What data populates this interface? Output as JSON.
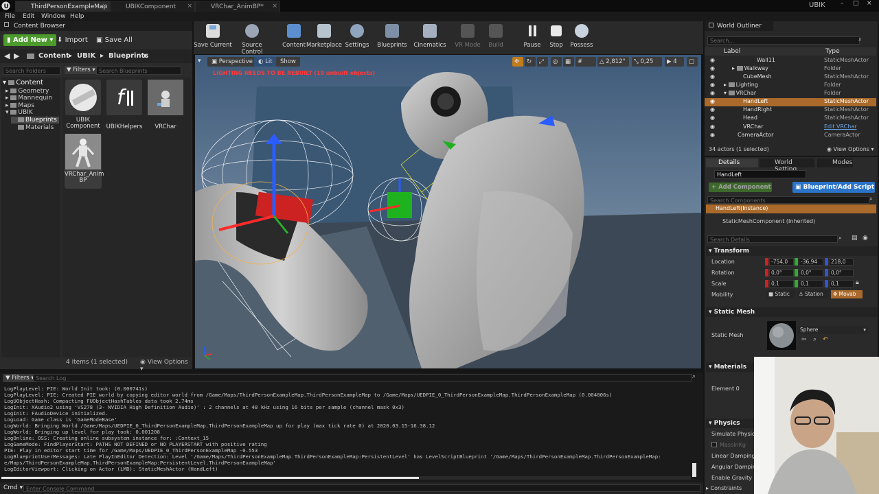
{
  "tabs": {
    "map": "ThirdPersonExampleMap",
    "ubik_component": "UBIKComponent",
    "anim_bp": "VRChar_AnimBP*",
    "right_label": "UBIK"
  },
  "menu": {
    "file": "File",
    "edit": "Edit",
    "window": "Window",
    "help": "Help"
  },
  "content_browser": {
    "title": "Content Browser",
    "add_new": "Add New",
    "import": "Import",
    "save_all": "Save All",
    "breadcrumb": [
      "Content",
      "UBIK",
      "Blueprints"
    ],
    "search_folders_placeholder": "Search Folders",
    "filters": "Filters",
    "search_blueprints_placeholder": "Search Blueprints",
    "tree": [
      "Content",
      "Geometry",
      "Mannequin",
      "Maps",
      "UBIK",
      "Blueprints",
      "Materials"
    ],
    "assets": [
      {
        "name": "UBIK Component"
      },
      {
        "name": "UBIKHelpers"
      },
      {
        "name": "VRChar"
      },
      {
        "name": "VRChar_Anim BP"
      }
    ],
    "status": "4 items (1 selected)",
    "view_options": "View Options"
  },
  "toolbar": {
    "save_current": "Save Current",
    "source_control": "Source Control",
    "content": "Content",
    "marketplace": "Marketplace",
    "settings": "Settings",
    "blueprints": "Blueprints",
    "cinematics": "Cinematics",
    "vr_mode": "VR Mode",
    "build": "Build",
    "pause": "Pause",
    "stop": "Stop",
    "possess": "Possess"
  },
  "viewport": {
    "perspective": "Perspective",
    "lit": "Lit",
    "show": "Show",
    "warning": "LIGHTING NEEDS TO BE REBUILT (19 unbuilt objects)",
    "grid_value": "2,812°",
    "scale_value": "0,25",
    "camera_speed": "4"
  },
  "outliner": {
    "title": "World Outliner",
    "search_placeholder": "Search...",
    "col_label": "Label",
    "col_type": "Type",
    "rows": [
      {
        "label": "Wall11",
        "type": "StaticMeshActor"
      },
      {
        "label": "Walkway",
        "type": "Folder"
      },
      {
        "label": "CubeMesh",
        "type": "StaticMeshActor"
      },
      {
        "label": "Lighting",
        "type": "Folder"
      },
      {
        "label": "VRChar",
        "type": "Folder"
      },
      {
        "label": "HandLeft",
        "type": "StaticMeshActor"
      },
      {
        "label": "HandRight",
        "type": "StaticMeshActor"
      },
      {
        "label": "Head",
        "type": "StaticMeshActor"
      },
      {
        "label": "VRChar",
        "type": "Edit VRChar"
      },
      {
        "label": "CameraActor",
        "type": "CameraActor"
      }
    ],
    "status": "34 actors (1 selected)",
    "view_options": "View Options"
  },
  "details": {
    "tab_details": "Details",
    "tab_world": "World Setting",
    "tab_modes": "Modes",
    "actor_name": "HandLeft",
    "add_component": "+ Add Component",
    "blueprint_button": "Blueprint/Add Script",
    "search_components_placeholder": "Search Components",
    "instance": "HandLeft(Instance)",
    "component": "StaticMeshComponent (Inherited)",
    "search_details_placeholder": "Search Details",
    "transform": "Transform",
    "location_label": "Location",
    "rotation_label": "Rotation",
    "scale_label": "Scale",
    "mobility_label": "Mobility",
    "location": [
      "-754,0",
      "-36,94",
      "218,0"
    ],
    "rotation": [
      "0,0°",
      "0,0°",
      "0,0°"
    ],
    "scale": [
      "0,1",
      "0,1",
      "0,1"
    ],
    "mobility": [
      "Static",
      "Station",
      "Movab"
    ],
    "static_mesh_section": "Static Mesh",
    "static_mesh_label": "Static Mesh",
    "mesh_value": "Sphere",
    "materials_section": "Materials",
    "element0": "Element 0",
    "physics_section": "Physics",
    "simulate_physics": "Simulate Physics",
    "mass": "MassInKg",
    "linear_damping": "Linear Damping",
    "angular_damping": "Angular Damping",
    "enable_gravity": "Enable Gravity",
    "constraints": "Constraints"
  },
  "log": {
    "filters": "Filters",
    "search_placeholder": "Search Log",
    "lines": [
      "LogPlayLevel: PIE: World Init took: (0.000741s)",
      "LogPlayLevel: PIE: Created PIE world by copying editor world from /Game/Maps/ThirdPersonExampleMap.ThirdPersonExampleMap to /Game/Maps/UEDPIE_0_ThirdPersonExampleMap.ThirdPersonExampleMap (0.004006s)",
      "LogUObjectHash: Compacting FUObjectHashTables data took   2.74ms",
      "LogInit: XAudio2 using 'VS278 (3- NVIDIA High Definition Audio)' : 2 channels at 48 kHz using 16 bits per sample (channel mask 0x3)",
      "LogInit: FAudioDevice initialized.",
      "LogLoad: Game class is 'GameModeBase'",
      "LogWorld: Bringing World /Game/Maps/UEDPIE_0_ThirdPersonExampleMap.ThirdPersonExampleMap up for play (max tick rate 0) at 2020.03.15-16.38.12",
      "LogWorld: Bringing up level for play took: 0.001208",
      "LogOnline: OSS: Creating online subsystem instance for: :Context_15",
      "LogGameMode: FindPlayerStart: PATHS NOT DEFINED or NO PLAYERSTART with positive rating",
      "PIE: Play in editor start time for /Game/Maps/UEDPIE_0_ThirdPersonExampleMap -0.553",
      "LogBlueprintUserMessages: Late PlayInEditor Detection: Level '/Game/Maps/ThirdPersonExampleMap.ThirdPersonExampleMap:PersistentLevel' has LevelScriptBlueprint '/Game/Maps/ThirdPersonExampleMap.ThirdPersonExampleMap:",
      "e/Maps/ThirdPersonExampleMap.ThirdPersonExampleMap:PersistentLevel.ThirdPersonExampleMap'",
      "LogEditorViewport: Clicking on Actor (LMB): StaticMeshActor (HandLeft)"
    ],
    "cmd_label": "Cmd",
    "cmd_placeholder": "Enter Console Command"
  },
  "colors": {
    "accent_orange": "#a96a2b",
    "accent_blue": "#2a73c7",
    "add_green": "#4c9b2c",
    "warning_red": "#ff4040"
  },
  "icons": [
    "ue4-logo-icon",
    "folder-icon",
    "save-icon",
    "source-control-icon",
    "content-icon",
    "marketplace-icon",
    "settings-icon",
    "blueprints-icon",
    "cinematics-icon",
    "vr-icon",
    "build-icon",
    "pause-icon",
    "stop-icon",
    "possess-icon",
    "eye-icon",
    "search-icon",
    "close-icon"
  ]
}
